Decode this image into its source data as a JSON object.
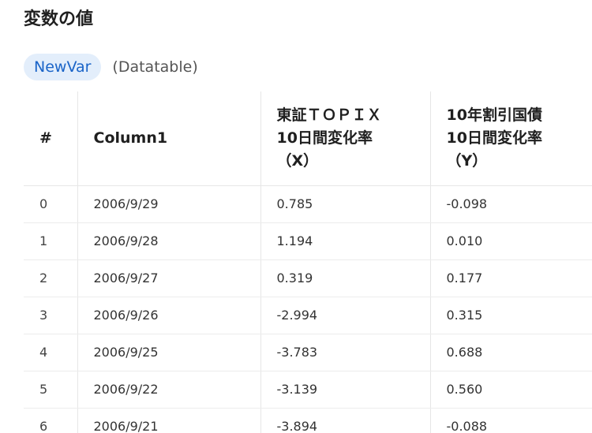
{
  "header": {
    "title": "変数の値"
  },
  "variable": {
    "name": "NewVar",
    "type": "(Datatable)"
  },
  "table": {
    "columns": [
      [
        "#"
      ],
      [
        "Column1"
      ],
      [
        "東証ＴＯＰＩＸ",
        "10日間変化率",
        "（X）"
      ],
      [
        "10年割引国債",
        "10日間変化率",
        "（Y）"
      ]
    ],
    "rows": [
      [
        "0",
        "2006/9/29",
        "0.785",
        "-0.098"
      ],
      [
        "1",
        "2006/9/28",
        "1.194",
        "0.010"
      ],
      [
        "2",
        "2006/9/27",
        "0.319",
        "0.177"
      ],
      [
        "3",
        "2006/9/26",
        "-2.994",
        "0.315"
      ],
      [
        "4",
        "2006/9/25",
        "-3.783",
        "0.688"
      ],
      [
        "5",
        "2006/9/22",
        "-3.139",
        "0.560"
      ],
      [
        "6",
        "2006/9/21",
        "-3.894",
        "-0.088"
      ]
    ]
  }
}
